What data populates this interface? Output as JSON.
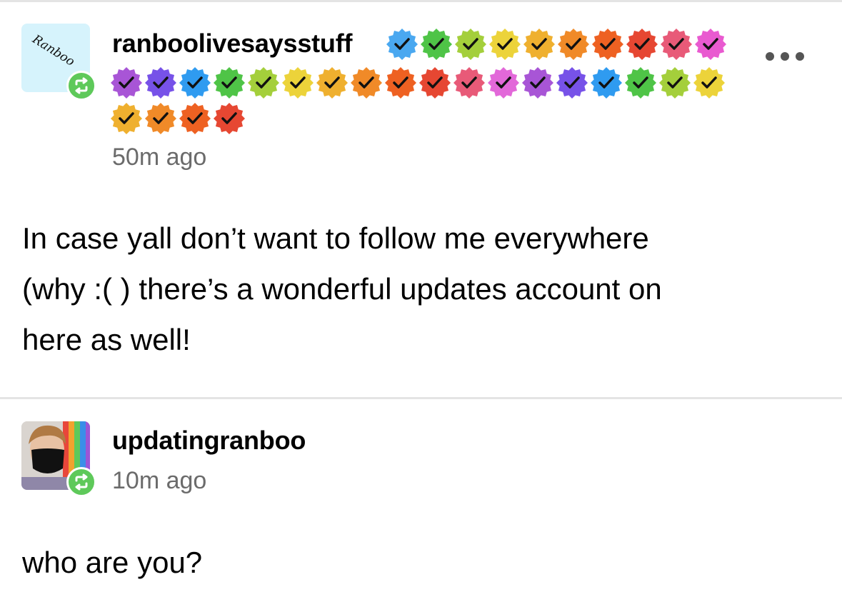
{
  "colors": {
    "reblog_badge": "#5ec95a",
    "divider": "#e4e4e4",
    "timestamp": "#6b6b6b",
    "checkmark_badges": {
      "row1": [
        "#4aa8f0",
        "#4fc447",
        "#a4cf3b",
        "#ecd33a",
        "#efb02f",
        "#f08a28",
        "#ee6122",
        "#e64732",
        "#e85a78",
        "#e95ad0"
      ],
      "row2": [
        "#a855d6",
        "#7752e8",
        "#2f9bf0",
        "#4fc447",
        "#a4cf3b",
        "#ecd33a",
        "#efb02f",
        "#f08a28",
        "#ee6122",
        "#e64732",
        "#e85a78",
        "#e268d9",
        "#a855d6",
        "#7752e8",
        "#2f9bf0",
        "#4fc447",
        "#a4cf3b",
        "#ecd33a"
      ],
      "row3": [
        "#efb02f",
        "#f08a28",
        "#ee6122",
        "#e64732"
      ]
    }
  },
  "post": {
    "author": {
      "avatar_icon": "avatar-ranboo-handwritten",
      "avatar_text": "Ranboo",
      "reblog_icon": "reblog-icon",
      "username": "ranboolivesaysstuff",
      "badge_icon": "checkmark-badge-icon",
      "timestamp": "50m ago"
    },
    "menu_icon": "more-options-icon",
    "body_lines": [
      "In case yall don’t want to follow me everywhere",
      "(why :( ) there’s a wonderful updates account on",
      "here as well!"
    ]
  },
  "reply": {
    "author": {
      "avatar_icon": "avatar-photo-masked-person",
      "reblog_icon": "reblog-icon",
      "username": "updatingranboo",
      "timestamp": "10m ago"
    },
    "body": "who are you?"
  }
}
